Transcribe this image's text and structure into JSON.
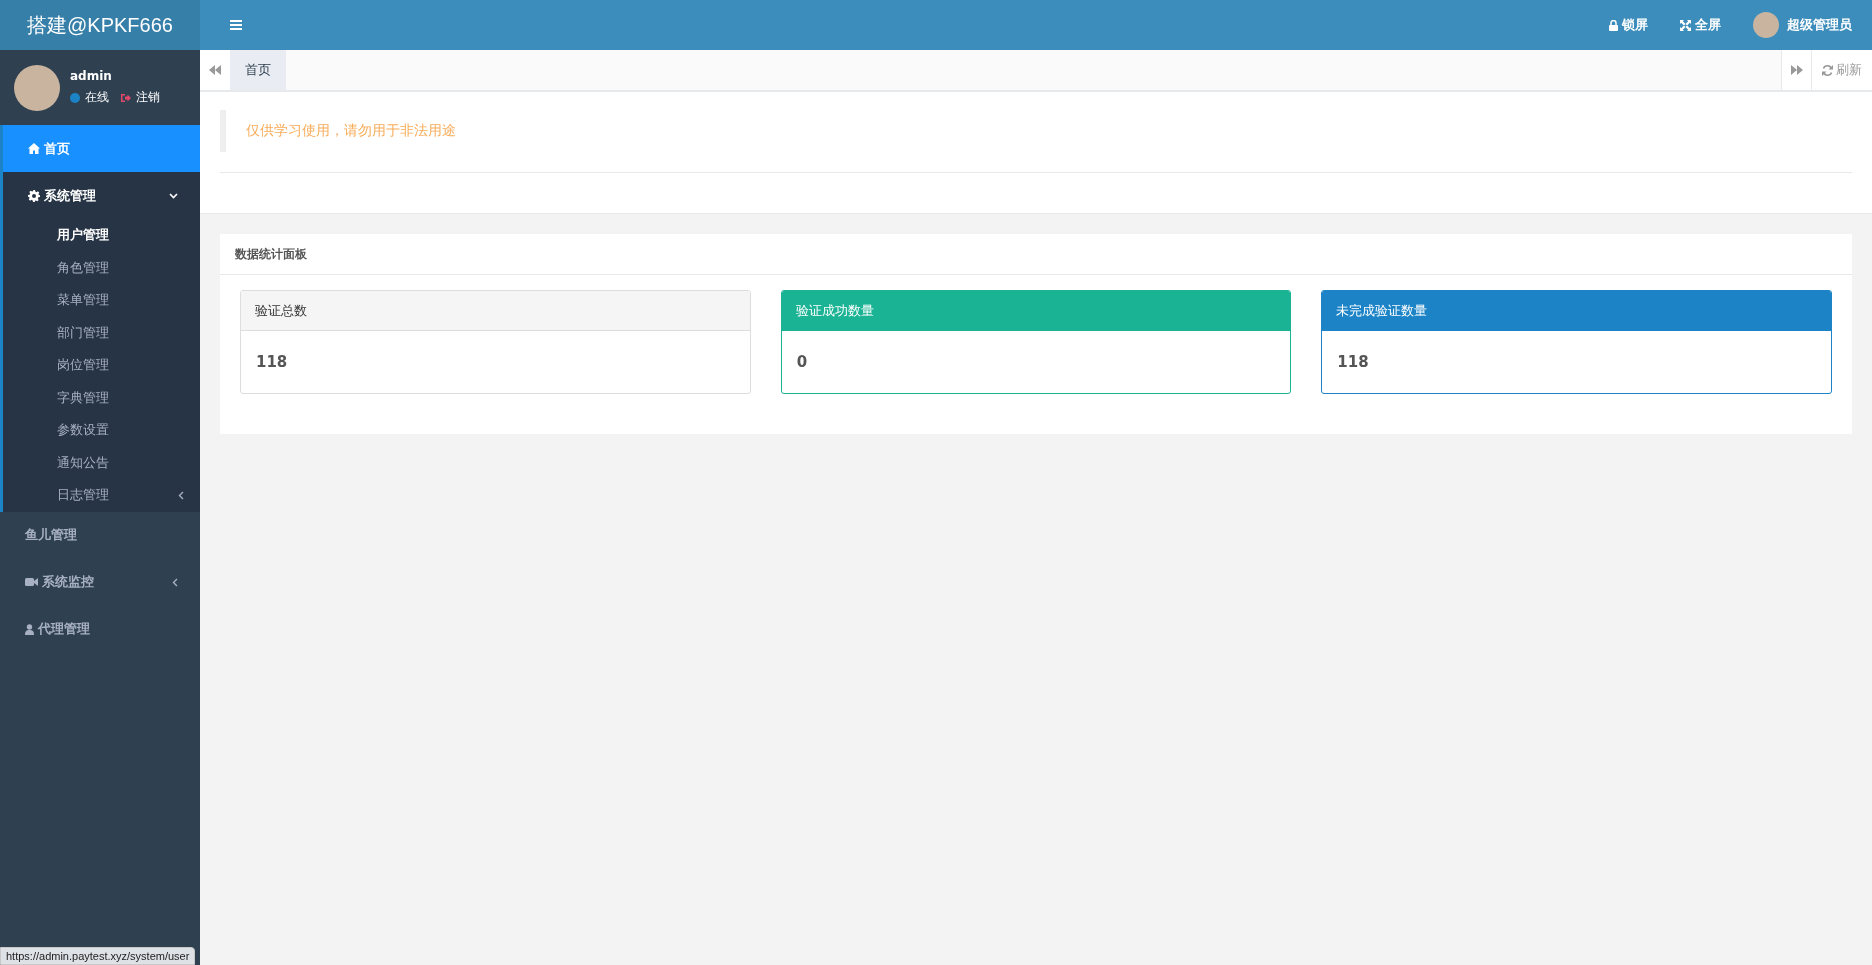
{
  "logo": "搭建@KPKF666",
  "topbar": {
    "lock": "锁屏",
    "fullscreen": "全屏",
    "user": "超级管理员"
  },
  "user_panel": {
    "name": "admin",
    "status": "在线",
    "logout": "注销"
  },
  "menu": [
    {
      "label": "首页",
      "kind": "home",
      "selected": true
    },
    {
      "label": "系统管理",
      "kind": "gear",
      "selected": false,
      "expanded": true,
      "children": [
        {
          "label": "用户管理",
          "selected": true
        },
        {
          "label": "角色管理",
          "selected": false
        },
        {
          "label": "菜单管理",
          "selected": false
        },
        {
          "label": "部门管理",
          "selected": false
        },
        {
          "label": "岗位管理",
          "selected": false
        },
        {
          "label": "字典管理",
          "selected": false
        },
        {
          "label": "参数设置",
          "selected": false
        },
        {
          "label": "通知公告",
          "selected": false
        },
        {
          "label": "日志管理",
          "selected": false,
          "expanded": false
        }
      ]
    },
    {
      "label": "鱼儿管理",
      "kind": "plain",
      "selected": false
    },
    {
      "label": "系统监控",
      "kind": "video",
      "selected": false,
      "expanded": false
    },
    {
      "label": "代理管理",
      "kind": "user",
      "selected": false
    }
  ],
  "tabs": [
    {
      "label": "首页",
      "selected": true
    }
  ],
  "refresh": "刷新",
  "notice": "仅供学习使用，请勿用于非法用途",
  "panel": {
    "title": "数据统计面板",
    "cards": [
      {
        "kind": "default",
        "title": "验证总数",
        "value": "118"
      },
      {
        "kind": "success",
        "title": "验证成功数量",
        "value": "0"
      },
      {
        "kind": "primary",
        "title": "未完成验证数量",
        "value": "118"
      }
    ]
  },
  "status_bar": "https://admin.paytest.xyz/system/user"
}
